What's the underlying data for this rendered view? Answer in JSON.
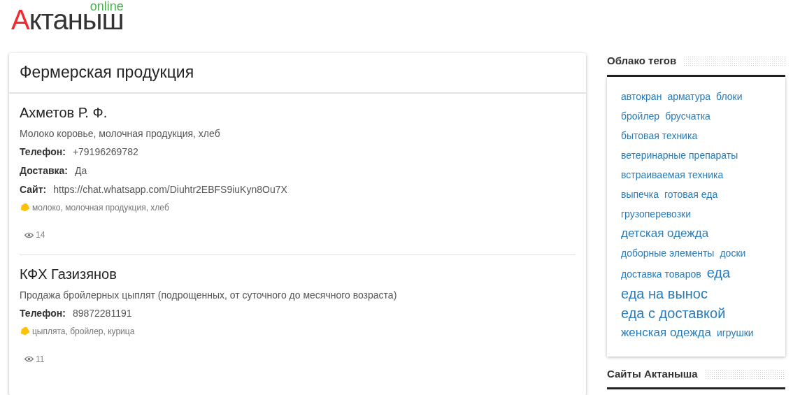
{
  "logo": {
    "initial": "А",
    "rest": "ктаныш",
    "suffix": "online"
  },
  "section": {
    "title": "Фермерская продукция",
    "entries": [
      {
        "name": "Ахметов Р. Ф.",
        "description": "Молоко коровье, молочная продукция, хлеб",
        "fields": [
          {
            "label": "Телефон:",
            "value": "+79196269782"
          },
          {
            "label": "Доставка:",
            "value": "Да"
          },
          {
            "label": "Сайт:",
            "value": "https://chat.whatsapp.com/Diuhtr2EBFS9iuKyn8Ou7X"
          }
        ],
        "tags": "молоко, молочная продукция, хлеб",
        "views": "14"
      },
      {
        "name": "КФХ Газизянов",
        "description": "Продажа бройлерных цыплят (подрощенных, от суточного до месячного возраста)",
        "fields": [
          {
            "label": "Телефон:",
            "value": "89872281191"
          }
        ],
        "tags": "цыплята, бройлер, курица",
        "views": "11"
      }
    ]
  },
  "sidebar": [
    {
      "title": "Облако тегов",
      "tags": [
        {
          "label": "автокран",
          "kind": "small"
        },
        {
          "label": "арматура",
          "kind": "small"
        },
        {
          "label": "блоки",
          "kind": "small"
        },
        {
          "label": "бройлер",
          "kind": "small"
        },
        {
          "label": "брусчатка",
          "kind": "small"
        },
        {
          "label": "бытовая техника",
          "kind": "small"
        },
        {
          "label": "ветеринарные препараты",
          "kind": "small"
        },
        {
          "label": "встраиваемая техника",
          "kind": "small"
        },
        {
          "label": "выпечка",
          "kind": "small"
        },
        {
          "label": "готовая еда",
          "kind": "small"
        },
        {
          "label": "грузоперевозки",
          "kind": "small"
        },
        {
          "label": "детская одежда",
          "kind": "medium"
        },
        {
          "label": "доборные элементы",
          "kind": "small"
        },
        {
          "label": "доски",
          "kind": "small"
        },
        {
          "label": "доставка товаров",
          "kind": "small"
        },
        {
          "label": "еда",
          "kind": "large"
        },
        {
          "label": "еда на вынос",
          "kind": "large"
        },
        {
          "label": "еда с доставкой",
          "kind": "large"
        },
        {
          "label": "женская одежда",
          "kind": "medium"
        },
        {
          "label": "игрушки",
          "kind": "small"
        }
      ]
    },
    {
      "title": "Сайты Актаныша"
    }
  ]
}
